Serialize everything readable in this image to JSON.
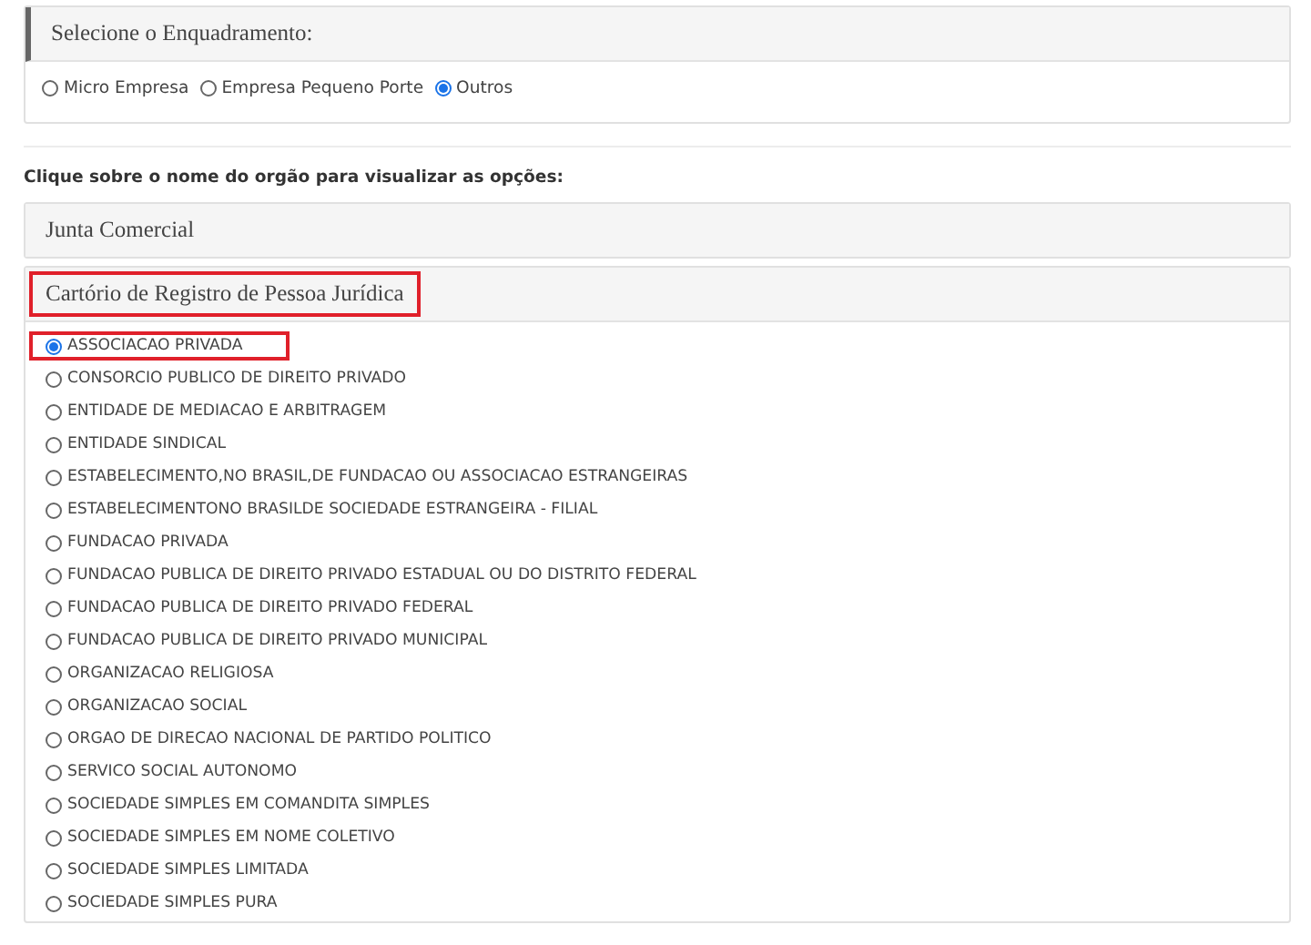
{
  "enquadramento": {
    "title": "Selecione o Enquadramento:",
    "options": [
      {
        "label": "Micro Empresa",
        "selected": false
      },
      {
        "label": "Empresa Pequeno Porte",
        "selected": false
      },
      {
        "label": "Outros",
        "selected": true
      }
    ]
  },
  "instruction": "Clique sobre o nome do orgão para visualizar as opções:",
  "orgaos": [
    {
      "title": "Junta Comercial",
      "highlighted": false,
      "expanded": false
    },
    {
      "title": "Cartório de Registro de Pessoa Jurídica",
      "highlighted": true,
      "expanded": true,
      "options": [
        {
          "label": "ASSOCIACAO PRIVADA",
          "selected": true,
          "highlighted": true
        },
        {
          "label": "CONSORCIO PUBLICO DE DIREITO PRIVADO",
          "selected": false,
          "highlighted": false
        },
        {
          "label": "ENTIDADE DE MEDIACAO E ARBITRAGEM",
          "selected": false,
          "highlighted": false
        },
        {
          "label": "ENTIDADE SINDICAL",
          "selected": false,
          "highlighted": false
        },
        {
          "label": "ESTABELECIMENTO,NO BRASIL,DE FUNDACAO OU ASSOCIACAO ESTRANGEIRAS",
          "selected": false,
          "highlighted": false
        },
        {
          "label": "ESTABELECIMENTONO BRASILDE SOCIEDADE ESTRANGEIRA - FILIAL",
          "selected": false,
          "highlighted": false
        },
        {
          "label": "FUNDACAO PRIVADA",
          "selected": false,
          "highlighted": false
        },
        {
          "label": "FUNDACAO PUBLICA DE DIREITO PRIVADO ESTADUAL OU DO DISTRITO FEDERAL",
          "selected": false,
          "highlighted": false
        },
        {
          "label": "FUNDACAO PUBLICA DE DIREITO PRIVADO FEDERAL",
          "selected": false,
          "highlighted": false
        },
        {
          "label": "FUNDACAO PUBLICA DE DIREITO PRIVADO MUNICIPAL",
          "selected": false,
          "highlighted": false
        },
        {
          "label": "ORGANIZACAO RELIGIOSA",
          "selected": false,
          "highlighted": false
        },
        {
          "label": "ORGANIZACAO SOCIAL",
          "selected": false,
          "highlighted": false
        },
        {
          "label": "ORGAO DE DIRECAO NACIONAL DE PARTIDO POLITICO",
          "selected": false,
          "highlighted": false
        },
        {
          "label": "SERVICO SOCIAL AUTONOMO",
          "selected": false,
          "highlighted": false
        },
        {
          "label": "SOCIEDADE SIMPLES EM COMANDITA SIMPLES",
          "selected": false,
          "highlighted": false
        },
        {
          "label": "SOCIEDADE SIMPLES EM NOME COLETIVO",
          "selected": false,
          "highlighted": false
        },
        {
          "label": "SOCIEDADE SIMPLES LIMITADA",
          "selected": false,
          "highlighted": false
        },
        {
          "label": "SOCIEDADE SIMPLES PURA",
          "selected": false,
          "highlighted": false
        }
      ]
    }
  ]
}
